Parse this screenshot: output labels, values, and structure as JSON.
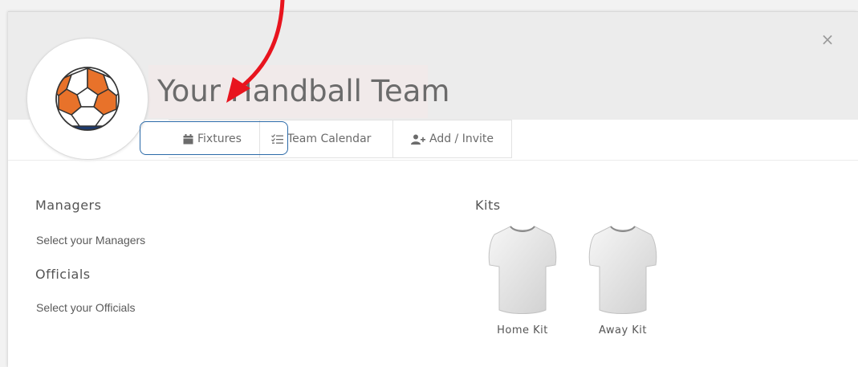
{
  "header": {
    "team_name": "Your Handball Team",
    "close_glyph": "×",
    "logo_icon": "handball-icon"
  },
  "tabs": [
    {
      "label": "Fixtures",
      "icon": "calendar-icon"
    },
    {
      "label": "Team Calendar",
      "icon": "checklist-icon"
    },
    {
      "label": "Add / Invite",
      "icon": "add-user-icon"
    }
  ],
  "managers": {
    "heading": "Managers",
    "placeholder": "Select your Managers"
  },
  "officials": {
    "heading": "Officials",
    "placeholder": "Select your Officials"
  },
  "kits": {
    "heading": "Kits",
    "items": [
      {
        "label": "Home Kit",
        "icon": "tshirt-icon"
      },
      {
        "label": "Away Kit",
        "icon": "tshirt-icon"
      }
    ]
  },
  "colors": {
    "ball_orange": "#e8722a",
    "ball_navy": "#1d3a6e",
    "annotation_red": "#e8141e",
    "highlight_blue": "#2b6aa8",
    "header_band": "#ececec"
  }
}
